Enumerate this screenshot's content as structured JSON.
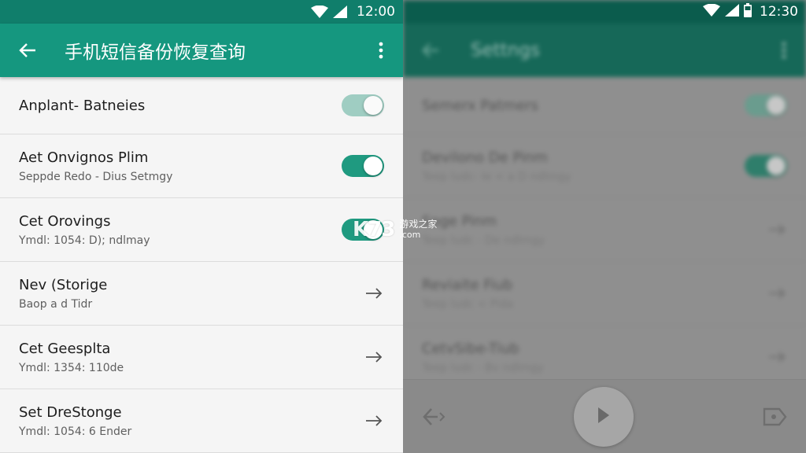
{
  "left_phone": {
    "status_bar": {
      "time": "12:00"
    },
    "app_bar": {
      "title": "手机短信备份恢复查询"
    },
    "settings": [
      {
        "title": "Anplant- Batneies",
        "subtitle": "",
        "control": "toggle",
        "state": "on-light"
      },
      {
        "title": "Aet Onvignos Plim",
        "subtitle": "Seppde Redo - Dius Setmgy",
        "control": "toggle",
        "state": "on"
      },
      {
        "title": "Cet Orovings",
        "subtitle": "Ymdl: 1054: D); ndlmay",
        "control": "toggle",
        "state": "on"
      },
      {
        "title": "Nev (Storige",
        "subtitle": "Baop a d Tidr",
        "control": "arrow"
      },
      {
        "title": "Cet Geesplta",
        "subtitle": "Ymdl: 1354: 110de",
        "control": "arrow"
      },
      {
        "title": "Set DreStonge",
        "subtitle": "Ymdl: 1054: 6 Ender",
        "control": "arrow"
      }
    ]
  },
  "right_phone": {
    "status_bar": {
      "time": "12:30"
    },
    "app_bar": {
      "title": "Settngs"
    },
    "settings": [
      {
        "title": "Semerx Patmers",
        "subtitle": "",
        "control": "toggle",
        "state": "on-light"
      },
      {
        "title": "Devilono De Pinm",
        "subtitle": "Teep ludc- Ie < a D ndlmgy",
        "control": "toggle",
        "state": "on"
      },
      {
        "title": "Soge Pinm",
        "subtitle": "Teep ludc - De ndlmgy",
        "control": "arrow"
      },
      {
        "title": "Reviaite Fiub",
        "subtitle": "Teep ludc < Pida",
        "control": "arrow"
      },
      {
        "title": "CetvSibe-Tiub",
        "subtitle": "Teep ludc - Bv ndlmgy",
        "control": "arrow"
      }
    ],
    "nav_bar": {
      "left_icon": "back-arrow-icon",
      "center_icon": "play-icon",
      "right_icon": "label-tag-icon"
    }
  },
  "watermark": {
    "logo": "K73",
    "cn": "游戏之家",
    "com": ".com"
  },
  "colors": {
    "status_bar": "#107e6b",
    "app_bar": "#15977f",
    "toggle_on": "#1f9a80",
    "background": "#f5f5f5"
  }
}
